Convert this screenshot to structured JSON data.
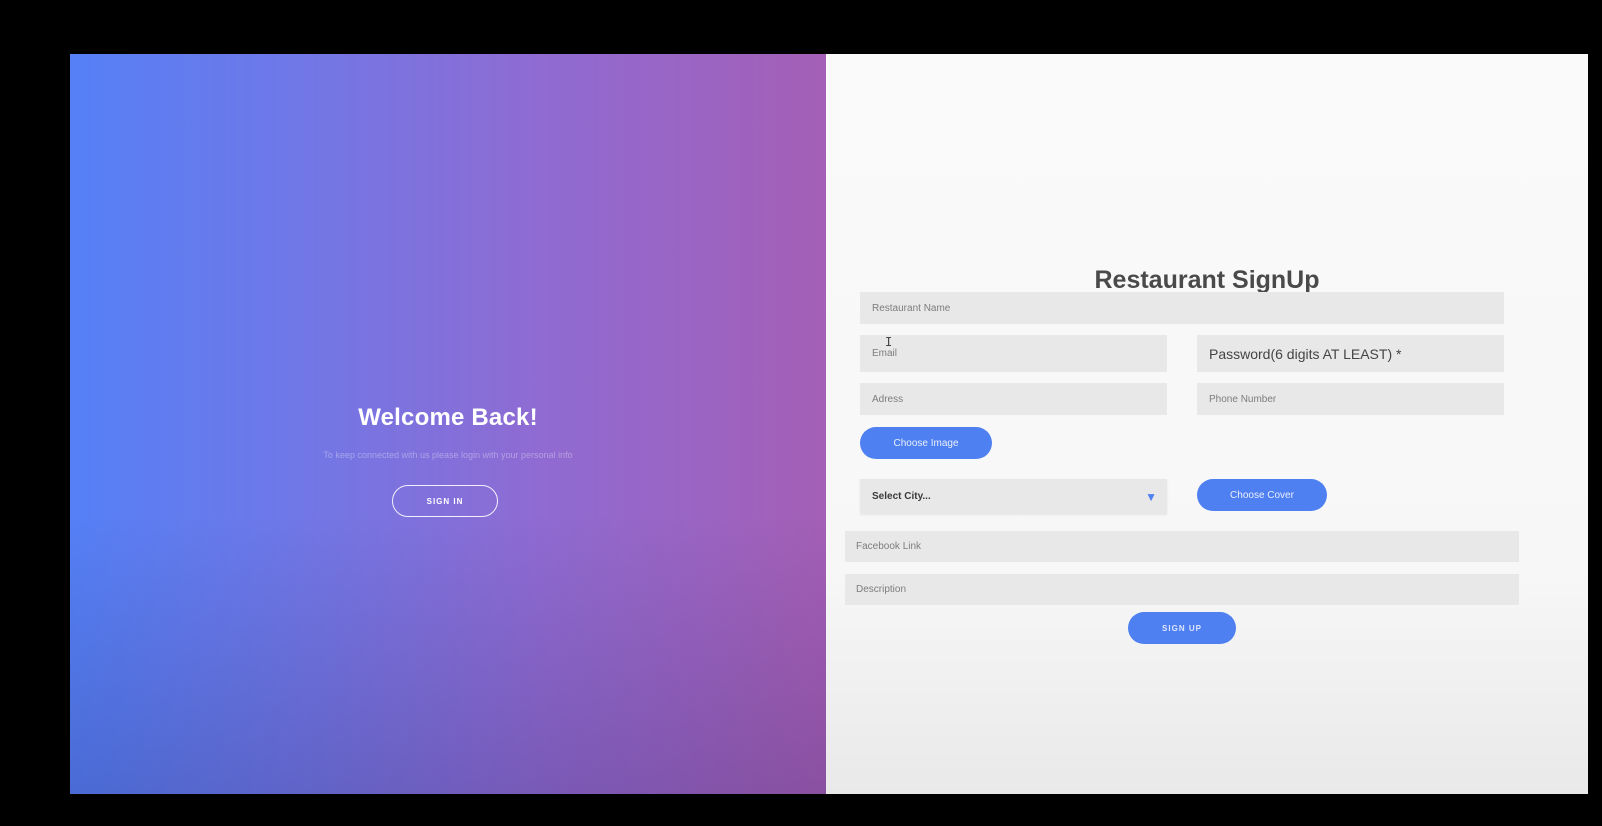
{
  "left": {
    "title": "Welcome Back!",
    "subtitle": "To keep connected with us please login with your personal info",
    "signin_label": "SIGN IN"
  },
  "form": {
    "title": "Restaurant SignUp",
    "restaurant_name_placeholder": "Restaurant Name",
    "email_placeholder": "Email",
    "password_placeholder": "Password(6 digits AT LEAST) *",
    "address_placeholder": "Adress",
    "phone_placeholder": "Phone Number",
    "choose_image_label": "Choose Image",
    "city_select_value": "Select City...",
    "city_select_arrow": "▼",
    "choose_cover_label": "Choose Cover",
    "facebook_placeholder": "Facebook Link",
    "description_placeholder": "Description",
    "signup_label": "SIGN UP"
  },
  "colors": {
    "gradient_start": "#5580f6",
    "gradient_end": "#a45fb6",
    "accent": "#4f80f2",
    "field_bg": "#e8e8e8"
  },
  "icons": {
    "text_cursor": "I"
  }
}
